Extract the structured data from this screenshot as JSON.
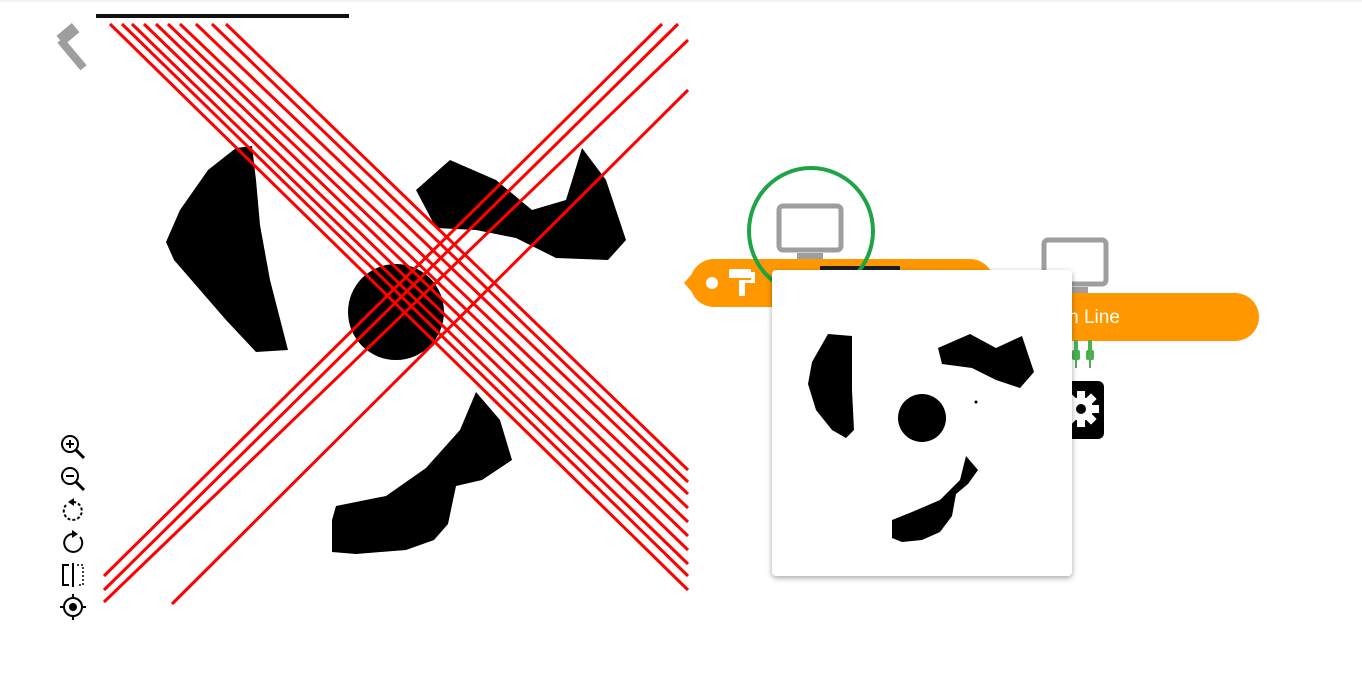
{
  "toolbar": {
    "tools": [
      {
        "icon": "zoom-in-icon"
      },
      {
        "icon": "zoom-out-icon"
      },
      {
        "icon": "rotate-left-icon"
      },
      {
        "icon": "rotate-right-icon"
      },
      {
        "icon": "flip-horizontal-icon"
      },
      {
        "icon": "center-target-icon"
      }
    ],
    "hammer_icon": "hammer-icon"
  },
  "nodes": {
    "paint_block": {
      "icon": "paint-roller-icon",
      "color": "#ff9800"
    },
    "hough_block": {
      "label": "ugh Line",
      "color": "#ff9800"
    },
    "monitor_icons": [
      "monitor-icon",
      "monitor-icon"
    ],
    "gear_icon": "gear-icon",
    "connector_icon": "connector-icon"
  },
  "highlight": {
    "color": "#1ea446"
  },
  "colors": {
    "lines": "#ff0000",
    "shapes": "#000000",
    "node": "#ff9800"
  }
}
